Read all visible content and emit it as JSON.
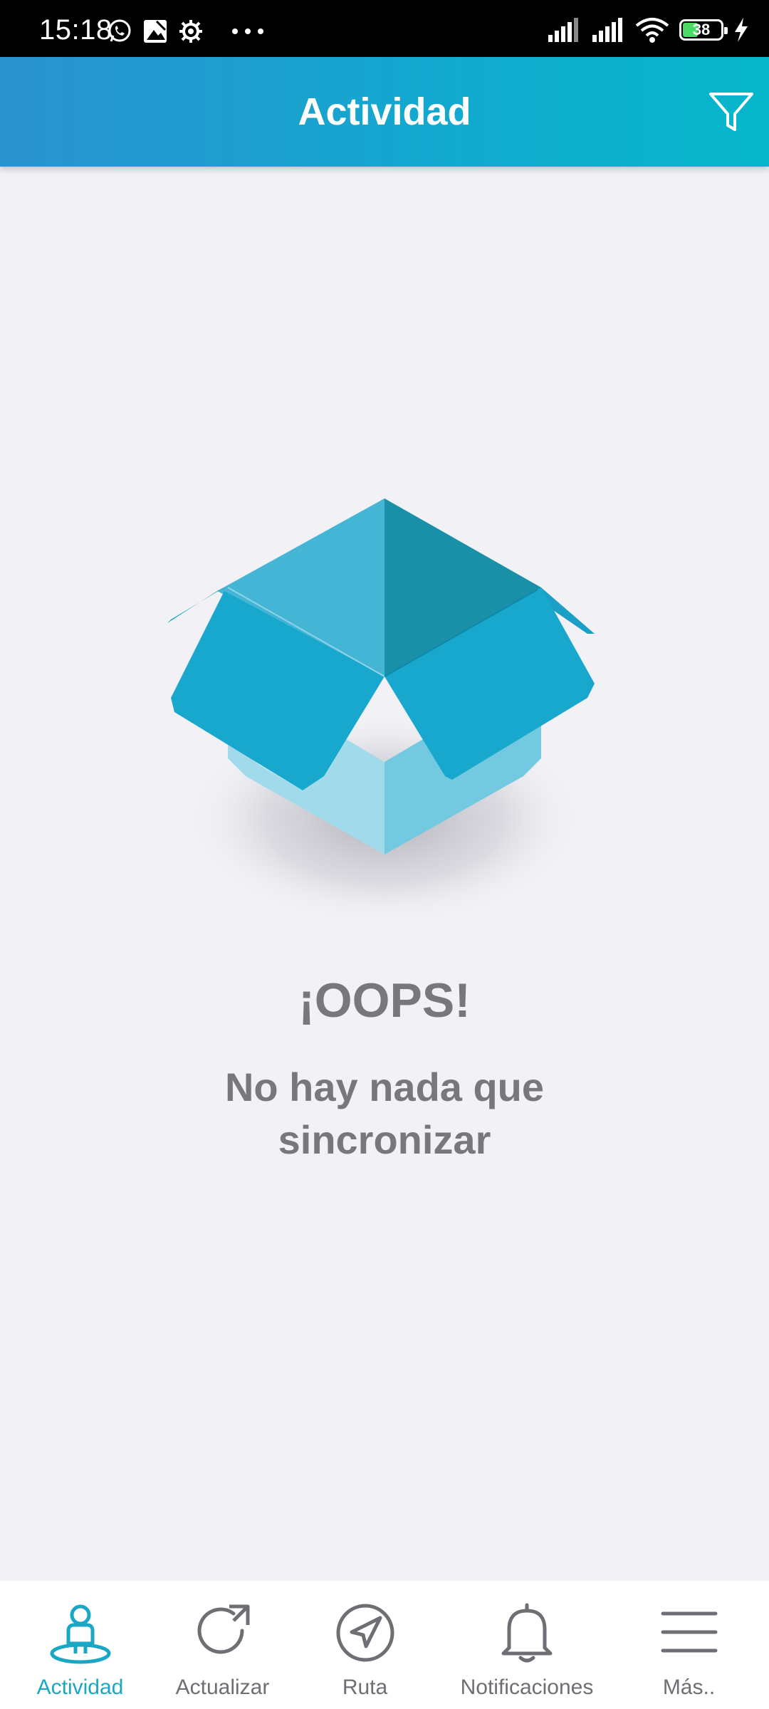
{
  "status_bar": {
    "time": "15:18",
    "battery_level": "38",
    "battery_fraction": 0.38,
    "left_icons": [
      "whatsapp-icon",
      "image-icon",
      "settings-gear-icon",
      "more-dots-icon"
    ],
    "right_icons": [
      "signal-icon",
      "signal-icon",
      "wifi-icon",
      "battery-icon",
      "charging-icon"
    ]
  },
  "header": {
    "title": "Actividad",
    "filter_icon": "filter-funnel-icon",
    "background_start": "#2b93d0",
    "background_end": "#06b7ca"
  },
  "empty_state": {
    "illustration": "open-box-illustration",
    "title": "¡OOPS!",
    "message": "No hay nada que sincronizar"
  },
  "bottom_nav": {
    "active_color": "#1aa7c3",
    "inactive_color": "#6e6e74",
    "items": [
      {
        "label": "Actividad",
        "icon": "person-pin-icon",
        "active": true
      },
      {
        "label": "Actualizar",
        "icon": "refresh-icon",
        "active": false
      },
      {
        "label": "Ruta",
        "icon": "navigation-arrow-icon",
        "active": false
      },
      {
        "label": "Notificaciones",
        "icon": "bell-icon",
        "active": false
      },
      {
        "label": "Más..",
        "icon": "menu-hamburger-icon",
        "active": false
      }
    ]
  }
}
